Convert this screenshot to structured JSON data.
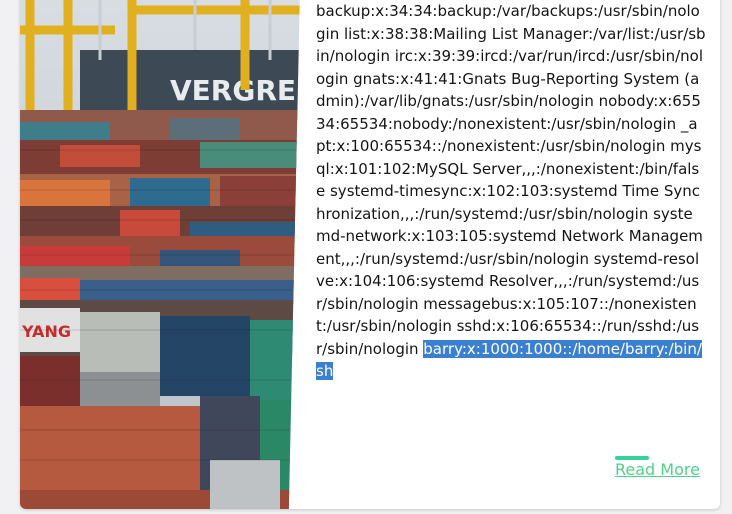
{
  "post": {
    "excerpt_text": "backup:x:34:34:backup:/var/backups:/usr/sbin/nologin list:x:38:38:Mailing List Manager:/var/list:/usr/sbin/nologin irc:x:39:39:ircd:/var/run/ircd:/usr/sbin/nologin gnats:x:41:41:Gnats Bug-Reporting System (admin):/var/lib/gnats:/usr/sbin/nologin nobody:x:65534:65534:nobody:/nonexistent:/usr/sbin/nologin _apt:x:100:65534::/nonexistent:/usr/sbin/nologin mysql:x:101:102:MySQL Server,,,:/nonexistent:/bin/false systemd-timesync:x:102:103:systemd Time Synchronization,,,:/run/systemd:/usr/sbin/nologin systemd-network:x:103:105:systemd Network Management,,,:/run/systemd:/usr/sbin/nologin systemd-resolve:x:104:106:systemd Resolver,,,:/run/systemd:/usr/sbin/nologin messagebus:x:105:107::/nonexistent:/usr/sbin/nologin sshd:x:106:65534::/run/sshd:/usr/sbin/nologin ",
    "selected_text": "barry:x:1000:1000::/home/barry:/bin/sh",
    "read_more_label": "Read More"
  },
  "image": {
    "description": "",
    "sign_text": "VERGRE",
    "container_text": "YANG"
  },
  "colors": {
    "selection": "#3b7fd1",
    "link": "#4fd18a",
    "accent": "#34d399"
  }
}
